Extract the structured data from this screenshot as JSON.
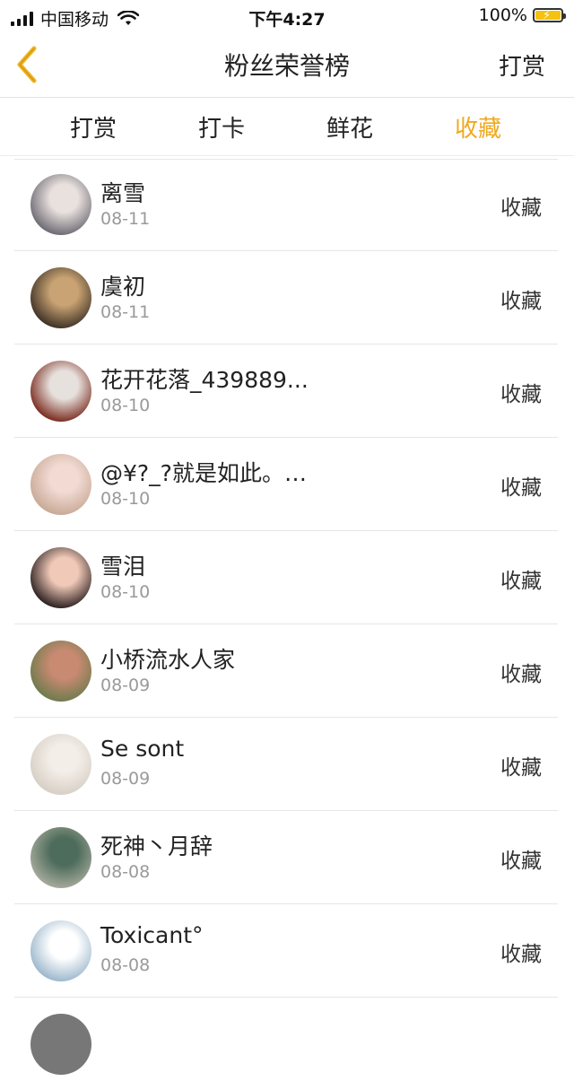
{
  "status_bar": {
    "carrier": "中国移动",
    "time": "下午4:27",
    "battery": "100%"
  },
  "nav": {
    "title": "粉丝荣誉榜",
    "right_label": "打赏"
  },
  "tabs": [
    {
      "label": "打赏",
      "active": false
    },
    {
      "label": "打卡",
      "active": false
    },
    {
      "label": "鲜花",
      "active": false
    },
    {
      "label": "收藏",
      "active": true
    }
  ],
  "accent_color": "#f0a81e",
  "list": [
    {
      "name": "离雪",
      "date": "08-11",
      "action": "收藏",
      "avatar_colors": [
        "#6d6a73",
        "#e9e1de"
      ]
    },
    {
      "name": "虞初",
      "date": "08-11",
      "action": "收藏",
      "avatar_colors": [
        "#3e3226",
        "#c9a373"
      ]
    },
    {
      "name": "花开花落_439889...",
      "date": "08-10",
      "action": "收藏",
      "avatar_colors": [
        "#7a2b1f",
        "#e7e1dd"
      ]
    },
    {
      "name": "@¥?_?就是如此。…",
      "date": "08-10",
      "action": "收藏",
      "avatar_colors": [
        "#c8a996",
        "#f2dbd3"
      ]
    },
    {
      "name": "雪泪",
      "date": "08-10",
      "action": "收藏",
      "avatar_colors": [
        "#2b2020",
        "#f1c9b8"
      ]
    },
    {
      "name": "小桥流水人家",
      "date": "08-09",
      "action": "收藏",
      "avatar_colors": [
        "#6e7b4d",
        "#c98a72"
      ]
    },
    {
      "name": "Se sont",
      "date": "08-09",
      "action": "收藏",
      "avatar_colors": [
        "#d7cfc6",
        "#f3eee8"
      ]
    },
    {
      "name": "死神丶月辞",
      "date": "08-08",
      "action": "收藏",
      "avatar_colors": [
        "#a6ab9c",
        "#4e6c5b"
      ]
    },
    {
      "name": "Toxicant°",
      "date": "08-08",
      "action": "收藏",
      "avatar_colors": [
        "#9cb7cc",
        "#ffffff"
      ]
    }
  ]
}
